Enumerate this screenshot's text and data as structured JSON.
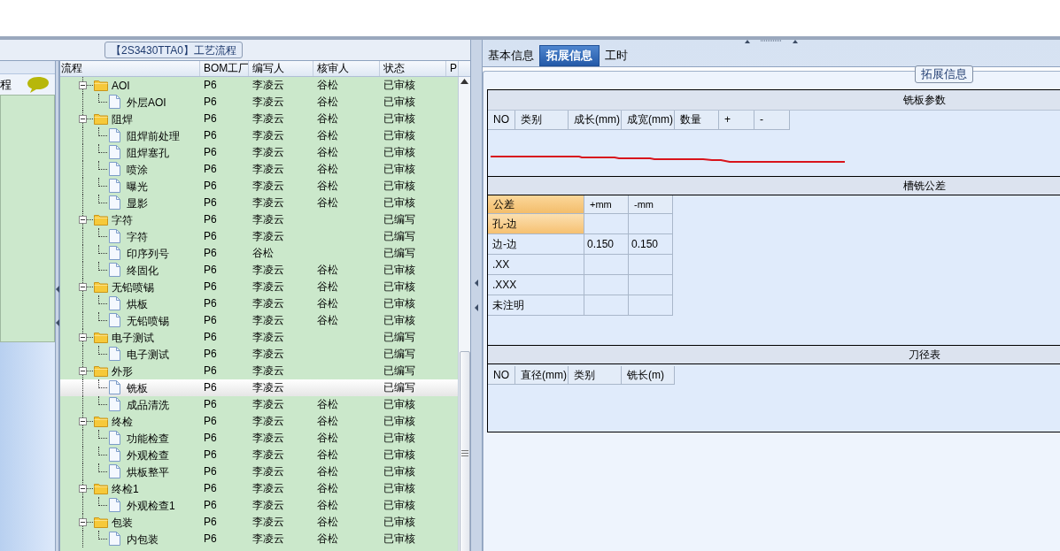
{
  "left_panel": {
    "label": "程"
  },
  "process_tree": {
    "title": "【2S3430TTA0】工艺流程",
    "columns": [
      "流程",
      "BOM工厂",
      "编写人",
      "核审人",
      "状态",
      "P"
    ],
    "rows": [
      {
        "label": "AOI",
        "factory": "P6",
        "author": "李凌云",
        "reviewer": "谷松",
        "status": "已审核",
        "expanded": true,
        "selected": false,
        "children": [
          {
            "label": "外层AOI",
            "factory": "P6",
            "author": "李凌云",
            "reviewer": "谷松",
            "status": "已审核",
            "selected": false
          }
        ]
      },
      {
        "label": "阻焊",
        "factory": "P6",
        "author": "李凌云",
        "reviewer": "谷松",
        "status": "已审核",
        "expanded": true,
        "selected": false,
        "children": [
          {
            "label": "阻焊前处理",
            "factory": "P6",
            "author": "李凌云",
            "reviewer": "谷松",
            "status": "已审核",
            "selected": false
          },
          {
            "label": "阻焊塞孔",
            "factory": "P6",
            "author": "李凌云",
            "reviewer": "谷松",
            "status": "已审核",
            "selected": false
          },
          {
            "label": "喷涂",
            "factory": "P6",
            "author": "李凌云",
            "reviewer": "谷松",
            "status": "已审核",
            "selected": false
          },
          {
            "label": "曝光",
            "factory": "P6",
            "author": "李凌云",
            "reviewer": "谷松",
            "status": "已审核",
            "selected": false
          },
          {
            "label": "显影",
            "factory": "P6",
            "author": "李凌云",
            "reviewer": "谷松",
            "status": "已审核",
            "selected": false
          }
        ]
      },
      {
        "label": "字符",
        "factory": "P6",
        "author": "李凌云",
        "status": "已编写",
        "expanded": true,
        "selected": false,
        "children": [
          {
            "label": "字符",
            "factory": "P6",
            "author": "李凌云",
            "status": "已编写",
            "selected": false
          },
          {
            "label": "印序列号",
            "factory": "P6",
            "author": "谷松",
            "status": "已编写",
            "selected": false
          },
          {
            "label": "终固化",
            "factory": "P6",
            "author": "李凌云",
            "reviewer": "谷松",
            "status": "已审核",
            "selected": false
          }
        ]
      },
      {
        "label": "无铅喷锡",
        "factory": "P6",
        "author": "李凌云",
        "reviewer": "谷松",
        "status": "已审核",
        "expanded": true,
        "selected": false,
        "children": [
          {
            "label": "烘板",
            "factory": "P6",
            "author": "李凌云",
            "reviewer": "谷松",
            "status": "已审核",
            "selected": false
          },
          {
            "label": "无铅喷锡",
            "factory": "P6",
            "author": "李凌云",
            "reviewer": "谷松",
            "status": "已审核",
            "selected": false
          }
        ]
      },
      {
        "label": "电子测试",
        "factory": "P6",
        "author": "李凌云",
        "status": "已编写",
        "expanded": true,
        "selected": false,
        "children": [
          {
            "label": "电子测试",
            "factory": "P6",
            "author": "李凌云",
            "status": "已编写",
            "selected": false
          }
        ]
      },
      {
        "label": "外形",
        "factory": "P6",
        "author": "李凌云",
        "status": "已编写",
        "expanded": true,
        "selected": false,
        "children": [
          {
            "label": "铣板",
            "factory": "P6",
            "author": "李凌云",
            "status": "已编写",
            "selected": true
          },
          {
            "label": "成品清洗",
            "factory": "P6",
            "author": "李凌云",
            "reviewer": "谷松",
            "status": "已审核",
            "selected": false
          }
        ]
      },
      {
        "label": "终检",
        "factory": "P6",
        "author": "李凌云",
        "reviewer": "谷松",
        "status": "已审核",
        "expanded": true,
        "selected": false,
        "children": [
          {
            "label": "功能检查",
            "factory": "P6",
            "author": "李凌云",
            "reviewer": "谷松",
            "status": "已审核",
            "selected": false
          },
          {
            "label": "外观检查",
            "factory": "P6",
            "author": "李凌云",
            "reviewer": "谷松",
            "status": "已审核",
            "selected": false
          },
          {
            "label": "烘板整平",
            "factory": "P6",
            "author": "李凌云",
            "reviewer": "谷松",
            "status": "已审核",
            "selected": false
          }
        ]
      },
      {
        "label": "终检1",
        "factory": "P6",
        "author": "李凌云",
        "reviewer": "谷松",
        "status": "已审核",
        "expanded": true,
        "selected": false,
        "children": [
          {
            "label": "外观检查1",
            "factory": "P6",
            "author": "李凌云",
            "reviewer": "谷松",
            "status": "已审核",
            "selected": false
          }
        ]
      },
      {
        "label": "包装",
        "factory": "P6",
        "author": "李凌云",
        "reviewer": "谷松",
        "status": "已审核",
        "expanded": true,
        "selected": false,
        "children": [
          {
            "label": "内包装",
            "factory": "P6",
            "author": "李凌云",
            "reviewer": "谷松",
            "status": "已审核",
            "selected": false
          }
        ]
      }
    ]
  },
  "tabs": [
    {
      "label": "基本信息",
      "selected": false
    },
    {
      "label": "拓展信息",
      "selected": true
    },
    {
      "label": "工时",
      "selected": false
    }
  ],
  "group_title": "拓展信息",
  "milling_params": {
    "title": "铣板参数",
    "columns": [
      "NO",
      "类别",
      "成长(mm)",
      "成宽(mm)",
      "数量",
      "+",
      "-"
    ]
  },
  "slot_tolerance": {
    "title": "槽铣公差",
    "columns": [
      "公差",
      "+mm",
      "-mm"
    ],
    "rows": [
      {
        "label": "孔-边",
        "selected": true
      },
      {
        "label": "边-边",
        "plus": "0.150",
        "minus": "0.150",
        "selected": false
      },
      {
        "label": ".XX",
        "selected": false
      },
      {
        "label": ".XXX",
        "selected": false
      },
      {
        "label": "未注明",
        "selected": false
      }
    ]
  },
  "tool_diameter": {
    "title": "刀径表",
    "columns": [
      "NO",
      "直径(mm)",
      "类别",
      "铣长(m)"
    ]
  }
}
